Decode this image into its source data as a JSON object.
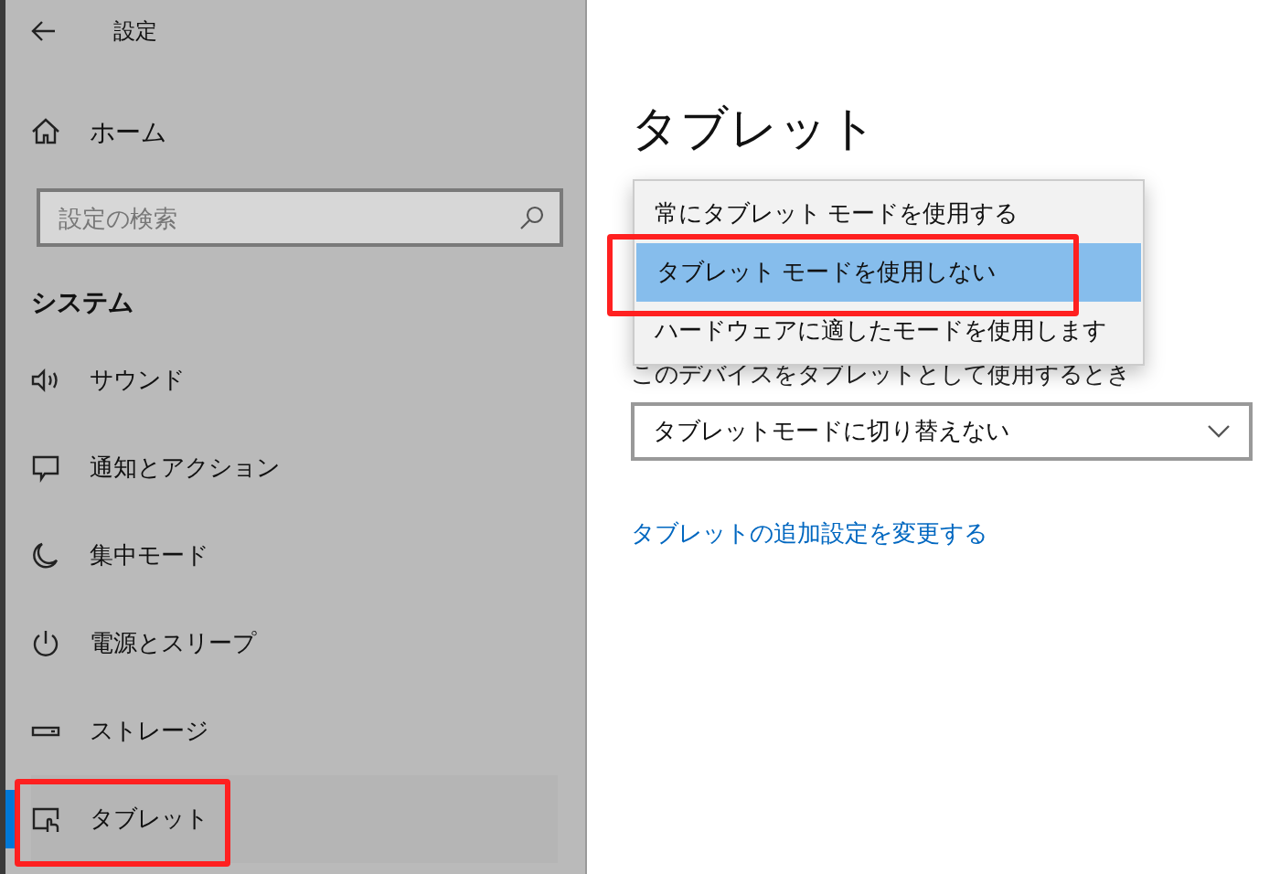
{
  "sidebar": {
    "title": "設定",
    "home": "ホーム",
    "search": {
      "placeholder": "設定の検索"
    },
    "section": "システム",
    "items": [
      {
        "label": "サウンド",
        "kind": "speaker",
        "selected": false,
        "highlighted": false
      },
      {
        "label": "通知とアクション",
        "kind": "message",
        "selected": false,
        "highlighted": false
      },
      {
        "label": "集中モード",
        "kind": "moon",
        "selected": false,
        "highlighted": false
      },
      {
        "label": "電源とスリープ",
        "kind": "power",
        "selected": false,
        "highlighted": false
      },
      {
        "label": "ストレージ",
        "kind": "storage",
        "selected": false,
        "highlighted": false
      },
      {
        "label": "タブレット",
        "kind": "tablet",
        "selected": true,
        "highlighted": true
      }
    ]
  },
  "main": {
    "title": "タブレット",
    "device_label": "このデバイスをタブレットとして使用するとき",
    "dropdown": {
      "value": "タブレットモードに切り替えない"
    },
    "menu": [
      {
        "label": "常にタブレット モードを使用する",
        "selected": false,
        "highlighted": false
      },
      {
        "label": "タブレット モードを使用しない",
        "selected": true,
        "highlighted": true
      },
      {
        "label": "ハードウェアに適したモードを使用します",
        "selected": false,
        "highlighted": false
      }
    ],
    "link": "タブレットの追加設定を変更する"
  }
}
